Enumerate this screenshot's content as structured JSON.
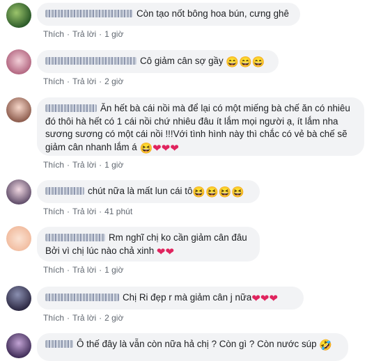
{
  "comments": [
    {
      "text": "Còn tạo nốt bông hoa bún, cưng ghê",
      "like": "Thích",
      "reply": "Trả lời",
      "time": "1 giờ",
      "emoji": ""
    },
    {
      "text": "Cô giảm cân sợ gầy",
      "like": "Thích",
      "reply": "Trả lời",
      "time": "2 giờ",
      "emoji": "😄😄😄"
    },
    {
      "text": "Ăn hết bà cái nồi mà để lại có một miếng bà chế ăn có nhiêu đó thôi hà hết có 1 cái nồi chứ nhiêu đâu ít lắm mọi người ạ, ít lắm nha sương sương có một cái nồi !!!Với tình hình này thì chắc có vẻ bà chế sẽ giảm cân nhanh lắm á",
      "like": "Thích",
      "reply": "Trả lời",
      "time": "1 giờ",
      "emoji": "😆❤❤❤"
    },
    {
      "text": "chút nữa là mất lun cái tô",
      "like": "Thích",
      "reply": "Trả lời",
      "time": "41 phút",
      "emoji": "😆😆😆😆"
    },
    {
      "text": "Rm nghĩ chị ko cần giảm cân đâu Bởi vì chị lúc nào chả xinh",
      "like": "Thích",
      "reply": "Trả lời",
      "time": "1 giờ",
      "emoji": "❤❤"
    },
    {
      "text": "Chị Ri đẹp r mà giảm cân j nữa",
      "like": "Thích",
      "reply": "Trả lời",
      "time": "2 giờ",
      "emoji": "❤❤❤"
    },
    {
      "text": "Ô thế đây là vẫn còn nữa hả chị ? Còn gì ? Còn nước súp",
      "like": "",
      "reply": "",
      "time": "",
      "emoji": "🤣"
    }
  ],
  "colors": {
    "bubble": "#f2f3f5",
    "meta": "#606770",
    "text": "#1c1e21",
    "heart": "#e0245e"
  }
}
